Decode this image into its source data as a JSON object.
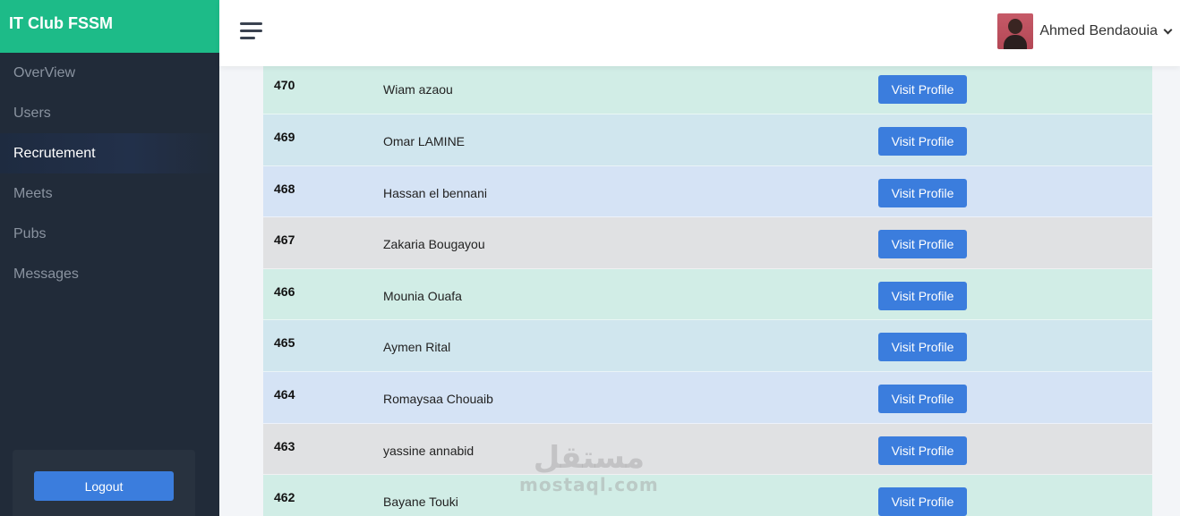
{
  "brand": {
    "title": "IT Club FSSM"
  },
  "sidebar": {
    "items": [
      {
        "label": "OverView",
        "active": false
      },
      {
        "label": "Users",
        "active": false
      },
      {
        "label": "Recrutement",
        "active": true
      },
      {
        "label": "Meets",
        "active": false
      },
      {
        "label": "Pubs",
        "active": false
      },
      {
        "label": "Messages",
        "active": false
      }
    ],
    "logout_label": "Logout"
  },
  "topbar": {
    "menu_icon": "hamburger-icon",
    "user_name": "Ahmed Bendaouia",
    "user_icon": "chevron-down-icon"
  },
  "table": {
    "rows": [
      {
        "id": "470",
        "name": "Wiam azaou",
        "action": "Visit Profile",
        "color": "#d1ede6"
      },
      {
        "id": "469",
        "name": "Omar LAMINE",
        "action": "Visit Profile",
        "color": "#d0e6ee"
      },
      {
        "id": "468",
        "name": "Hassan el bennani",
        "action": "Visit Profile",
        "color": "#d5e3f5"
      },
      {
        "id": "467",
        "name": "Zakaria Bougayou",
        "action": "Visit Profile",
        "color": "#e0e1e3"
      },
      {
        "id": "466",
        "name": "Mounia Ouafa",
        "action": "Visit Profile",
        "color": "#d1ede6"
      },
      {
        "id": "465",
        "name": "Aymen Rital",
        "action": "Visit Profile",
        "color": "#d0e6ee"
      },
      {
        "id": "464",
        "name": "Romaysaa Chouaib",
        "action": "Visit Profile",
        "color": "#d5e3f5"
      },
      {
        "id": "463",
        "name": "yassine annabid",
        "action": "Visit Profile",
        "color": "#e0e1e3"
      },
      {
        "id": "462",
        "name": "Bayane Touki",
        "action": "Visit Profile",
        "color": "#d1ede6"
      }
    ]
  },
  "watermark": {
    "arabic": "مستقل",
    "latin": "mostaql.com"
  },
  "colors": {
    "brand": "#1dbb88",
    "sidebar": "#212b39",
    "button": "#3b7ddd"
  }
}
